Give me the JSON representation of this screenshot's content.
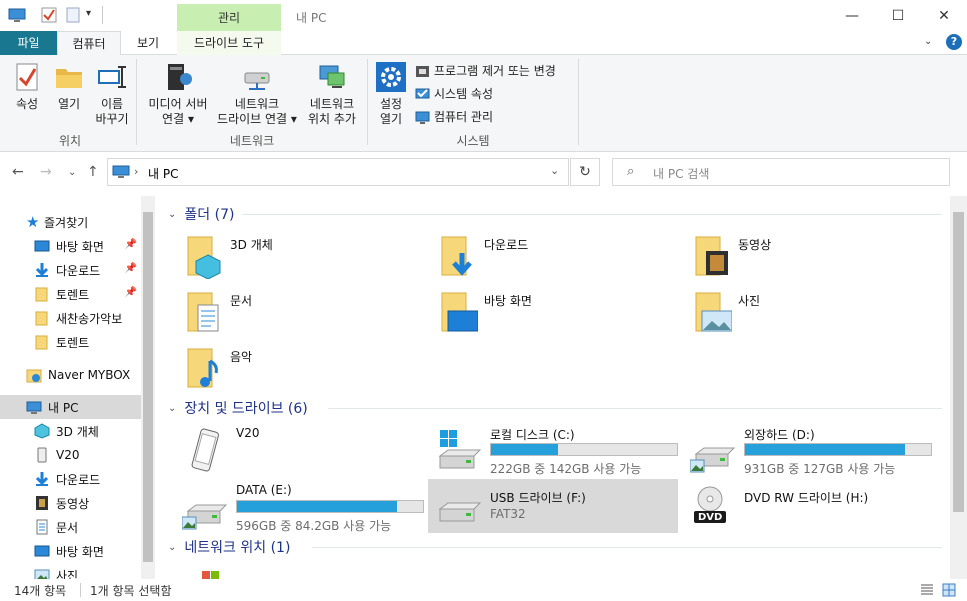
{
  "window": {
    "title": "내 PC",
    "contextual_tab_title": "관리",
    "controls": {
      "minimize": "—",
      "maximize": "☐",
      "close": "✕"
    }
  },
  "ribbon_tabs": {
    "file": "파일",
    "computer": "컴퓨터",
    "view": "보기",
    "drive_tools": "드라이브 도구"
  },
  "ribbon": {
    "location_group": {
      "label": "위치",
      "properties": "속성",
      "open": "열기",
      "rename_line1": "이름",
      "rename_line2": "바꾸기"
    },
    "network_group": {
      "label": "네트워크",
      "media_line1": "미디어 서버",
      "media_line2": "연결",
      "map_line1": "네트워크",
      "map_line2": "드라이브 연결",
      "addloc_line1": "네트워크",
      "addloc_line2": "위치 추가"
    },
    "system_group": {
      "label": "시스템",
      "settings_line1": "설정",
      "settings_line2": "열기",
      "uninstall": "프로그램 제거 또는 변경",
      "system_props": "시스템 속성",
      "manage": "컴퓨터 관리"
    }
  },
  "address": {
    "path": "내 PC",
    "search_placeholder": "내 PC 검색"
  },
  "sidebar": {
    "items": [
      {
        "label": "즐겨찾기",
        "pinned": false
      },
      {
        "label": "바탕 화면",
        "pinned": true
      },
      {
        "label": "다운로드",
        "pinned": true
      },
      {
        "label": "토렌트",
        "pinned": true
      },
      {
        "label": "새찬송가악보",
        "pinned": false
      },
      {
        "label": "토렌트",
        "pinned": false
      },
      {
        "label": "Naver MYBOX",
        "pinned": false
      },
      {
        "label": "내 PC",
        "pinned": false
      },
      {
        "label": "3D 개체",
        "pinned": false
      },
      {
        "label": "V20",
        "pinned": false
      },
      {
        "label": "다운로드",
        "pinned": false
      },
      {
        "label": "동영상",
        "pinned": false
      },
      {
        "label": "문서",
        "pinned": false
      },
      {
        "label": "바탕 화면",
        "pinned": false
      },
      {
        "label": "사진",
        "pinned": false
      }
    ],
    "pin_glyph": "📌"
  },
  "sections": {
    "folders": "폴더 (7)",
    "devices": "장치 및 드라이브 (6)",
    "network": "네트워크 위치 (1)"
  },
  "folders": [
    "3D 개체",
    "다운로드",
    "동영상",
    "문서",
    "바탕 화면",
    "사진",
    "음악"
  ],
  "drives": {
    "v20": {
      "name": "V20"
    },
    "c": {
      "name": "로컬 디스크 (C:)",
      "stats": "222GB 중 142GB 사용 가능",
      "used_fraction": 0.36
    },
    "d": {
      "name": "외장하드 (D:)",
      "stats": "931GB 중 127GB 사용 가능",
      "used_fraction": 0.86
    },
    "e": {
      "name": "DATA (E:)",
      "stats": "596GB 중 84.2GB 사용 가능",
      "used_fraction": 0.86
    },
    "f": {
      "name": "USB 드라이브 (F:)",
      "stats": "FAT32"
    },
    "h": {
      "name": "DVD RW 드라이브 (H:)",
      "badge": "DVD"
    }
  },
  "statusbar": {
    "count": "14개 항목",
    "selected": "1개 항목 선택함"
  },
  "colors": {
    "file_tab": "#19778f",
    "context_tab": "#c9eeb2",
    "bar_fill": "#26a0da",
    "section_text": "#1e3287",
    "selection": "#d9d9d9"
  }
}
